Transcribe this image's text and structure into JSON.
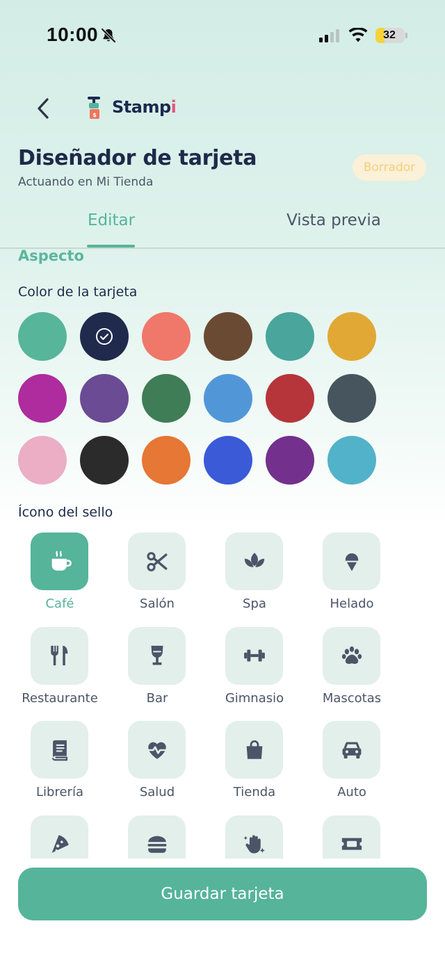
{
  "status_bar": {
    "time": "10:00",
    "battery": "32",
    "battery_level": 0.32
  },
  "header": {
    "app_name_main": "Stamp",
    "app_name_accent": "i"
  },
  "page": {
    "title": "Diseñador de tarjeta",
    "subtitle": "Actuando en Mi Tienda",
    "status_badge": "Borrador"
  },
  "tabs": [
    {
      "label": "Editar",
      "active": true
    },
    {
      "label": "Vista previa",
      "active": false
    }
  ],
  "appearance": {
    "section_title": "Aspecto",
    "card_color_label": "Color de la tarjeta",
    "selected_color": "#1f2a4d",
    "colors": [
      "#57b59a",
      "#1f2a4d",
      "#ef786a",
      "#6b4a33",
      "#4aa59c",
      "#e1a835",
      "#ae2c9e",
      "#6a4b94",
      "#3f7d56",
      "#5197d8",
      "#b6353a",
      "#46555e",
      "#ebaec4",
      "#2b2b2b",
      "#e67734",
      "#3a5ad8",
      "#73308d",
      "#52b2c9"
    ],
    "stamp_icon_label": "Ícono del sello",
    "icons": [
      {
        "name": "cafe",
        "label": "Café",
        "icon": "coffee-icon",
        "selected": true
      },
      {
        "name": "salon",
        "label": "Salón",
        "icon": "scissors-icon",
        "selected": false
      },
      {
        "name": "spa",
        "label": "Spa",
        "icon": "lotus-icon",
        "selected": false
      },
      {
        "name": "helado",
        "label": "Helado",
        "icon": "ice-cream-icon",
        "selected": false
      },
      {
        "name": "restaurante",
        "label": "Restaurante",
        "icon": "utensils-icon",
        "selected": false
      },
      {
        "name": "bar",
        "label": "Bar",
        "icon": "wine-glass-icon",
        "selected": false
      },
      {
        "name": "gimnasio",
        "label": "Gimnasio",
        "icon": "dumbbell-icon",
        "selected": false
      },
      {
        "name": "mascotas",
        "label": "Mascotas",
        "icon": "paw-icon",
        "selected": false
      },
      {
        "name": "libreria",
        "label": "Librería",
        "icon": "book-icon",
        "selected": false
      },
      {
        "name": "salud",
        "label": "Salud",
        "icon": "heart-pulse-icon",
        "selected": false
      },
      {
        "name": "tienda",
        "label": "Tienda",
        "icon": "shopping-bag-icon",
        "selected": false
      },
      {
        "name": "auto",
        "label": "Auto",
        "icon": "car-icon",
        "selected": false
      },
      {
        "name": "pizza",
        "label": "",
        "icon": "pizza-icon",
        "selected": false
      },
      {
        "name": "burger",
        "label": "",
        "icon": "burger-icon",
        "selected": false
      },
      {
        "name": "manicure",
        "label": "",
        "icon": "sparkle-hand-icon",
        "selected": false
      },
      {
        "name": "ticket",
        "label": "",
        "icon": "ticket-icon",
        "selected": false
      }
    ]
  },
  "actions": {
    "save_label": "Guardar tarjeta"
  },
  "theme": {
    "accent": "#55b49a",
    "ink": "#1d2a4a",
    "icon_color": "#4a5568"
  }
}
